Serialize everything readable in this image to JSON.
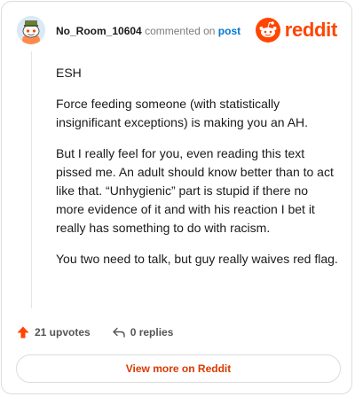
{
  "header": {
    "username": "No_Room_10604",
    "commented_text": "commented on",
    "post_link": "post",
    "brand": "reddit"
  },
  "comment": {
    "paragraphs": [
      "ESH",
      "Force feeding someone (with statistically insignificant exceptions) is making you an AH.",
      "But I really feel for you, even reading this text pissed me. An adult should know better than to act like that. “Unhygienic” part is stupid if there no more evidence of it and with his reaction I bet it really has something to do with racism.",
      "You two need to talk, but guy really waives red flag."
    ]
  },
  "actions": {
    "upvotes": "21 upvotes",
    "replies": "0 replies"
  },
  "cta": {
    "label": "View more on Reddit"
  },
  "colors": {
    "accent": "#ff4500",
    "link": "#0079d3"
  }
}
